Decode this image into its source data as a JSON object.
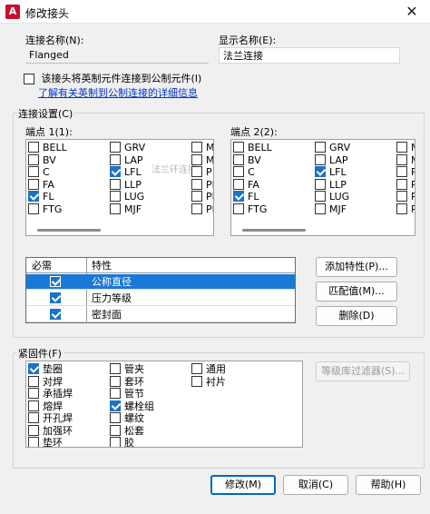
{
  "window": {
    "title": "修改接头",
    "app_icon": "A",
    "close_icon": "✕"
  },
  "connection_name": {
    "label": "连接名称(N):",
    "value": "Flanged"
  },
  "display_name": {
    "label": "显示名称(E):",
    "value": "法兰连接"
  },
  "imperial_option": {
    "label": "该接头将英制元件连接到公制元件(I)",
    "checked": false
  },
  "learn_more_link": "了解有关英制到公制连接的详细信息",
  "connection_settings": {
    "title": "连接设置(C)",
    "endpoint1": {
      "label": "端点 1(1):",
      "columns": [
        [
          {
            "label": "BELL",
            "checked": false
          },
          {
            "label": "BV",
            "checked": false
          },
          {
            "label": "C",
            "checked": false
          },
          {
            "label": "FA",
            "checked": false
          },
          {
            "label": "FL",
            "checked": true
          },
          {
            "label": "FTG",
            "checked": false
          }
        ],
        [
          {
            "label": "GRV",
            "checked": false
          },
          {
            "label": "LAP",
            "checked": false
          },
          {
            "label": "LFL",
            "checked": true
          },
          {
            "label": "LLP",
            "checked": false
          },
          {
            "label": "LUG",
            "checked": false
          },
          {
            "label": "MJF",
            "checked": false
          }
        ],
        [
          {
            "label": "M",
            "checked": false
          },
          {
            "label": "M",
            "checked": false
          },
          {
            "label": "P",
            "checked": false
          },
          {
            "label": "PI",
            "checked": false
          },
          {
            "label": "PL",
            "checked": false
          },
          {
            "label": "PF",
            "checked": false
          }
        ]
      ],
      "ghost_text": "法兰环连接"
    },
    "endpoint2": {
      "label": "端点 2(2):",
      "columns": [
        [
          {
            "label": "BELL",
            "checked": false
          },
          {
            "label": "BV",
            "checked": false
          },
          {
            "label": "C",
            "checked": false
          },
          {
            "label": "FA",
            "checked": false
          },
          {
            "label": "FL",
            "checked": true
          },
          {
            "label": "FTG",
            "checked": false
          }
        ],
        [
          {
            "label": "GRV",
            "checked": false
          },
          {
            "label": "LAP",
            "checked": false
          },
          {
            "label": "LFL",
            "checked": true
          },
          {
            "label": "LLP",
            "checked": false
          },
          {
            "label": "LUG",
            "checked": false
          },
          {
            "label": "MJF",
            "checked": false
          }
        ],
        [
          {
            "label": "M",
            "checked": false
          },
          {
            "label": "M",
            "checked": false
          },
          {
            "label": "P",
            "checked": false
          },
          {
            "label": "P",
            "checked": false
          },
          {
            "label": "P",
            "checked": false
          },
          {
            "label": "P",
            "checked": false
          }
        ]
      ]
    },
    "properties_table": {
      "headers": [
        "必需",
        "特性"
      ],
      "rows": [
        {
          "required": true,
          "name": "公称直径",
          "selected": true
        },
        {
          "required": true,
          "name": "压力等级",
          "selected": false
        },
        {
          "required": true,
          "name": "密封面",
          "selected": false
        }
      ]
    },
    "buttons": {
      "add_property": "添加特性(P)...",
      "match_value": "匹配值(M)...",
      "delete": "删除(D)"
    }
  },
  "fasteners": {
    "title": "紧固件(F)",
    "columns": [
      [
        {
          "label": "垫圈",
          "checked": true
        },
        {
          "label": "对焊",
          "checked": false
        },
        {
          "label": "承插焊",
          "checked": false
        },
        {
          "label": "熔焊",
          "checked": false
        },
        {
          "label": "开孔焊",
          "checked": false
        },
        {
          "label": "加强环",
          "checked": false
        },
        {
          "label": "垫环",
          "checked": false
        }
      ],
      [
        {
          "label": "管夹",
          "checked": false
        },
        {
          "label": "套环",
          "checked": false
        },
        {
          "label": "管节",
          "checked": false
        },
        {
          "label": "螺栓组",
          "checked": true
        },
        {
          "label": "螺纹",
          "checked": false
        },
        {
          "label": "松套",
          "checked": false
        },
        {
          "label": "胶",
          "checked": false
        }
      ],
      [
        {
          "label": "通用",
          "checked": false
        },
        {
          "label": "衬片",
          "checked": false
        }
      ]
    ],
    "spec_filter_button": "等级库过滤器(S)..."
  },
  "footer": {
    "modify": "修改(M)",
    "cancel": "取消(C)",
    "help": "帮助(H)"
  }
}
